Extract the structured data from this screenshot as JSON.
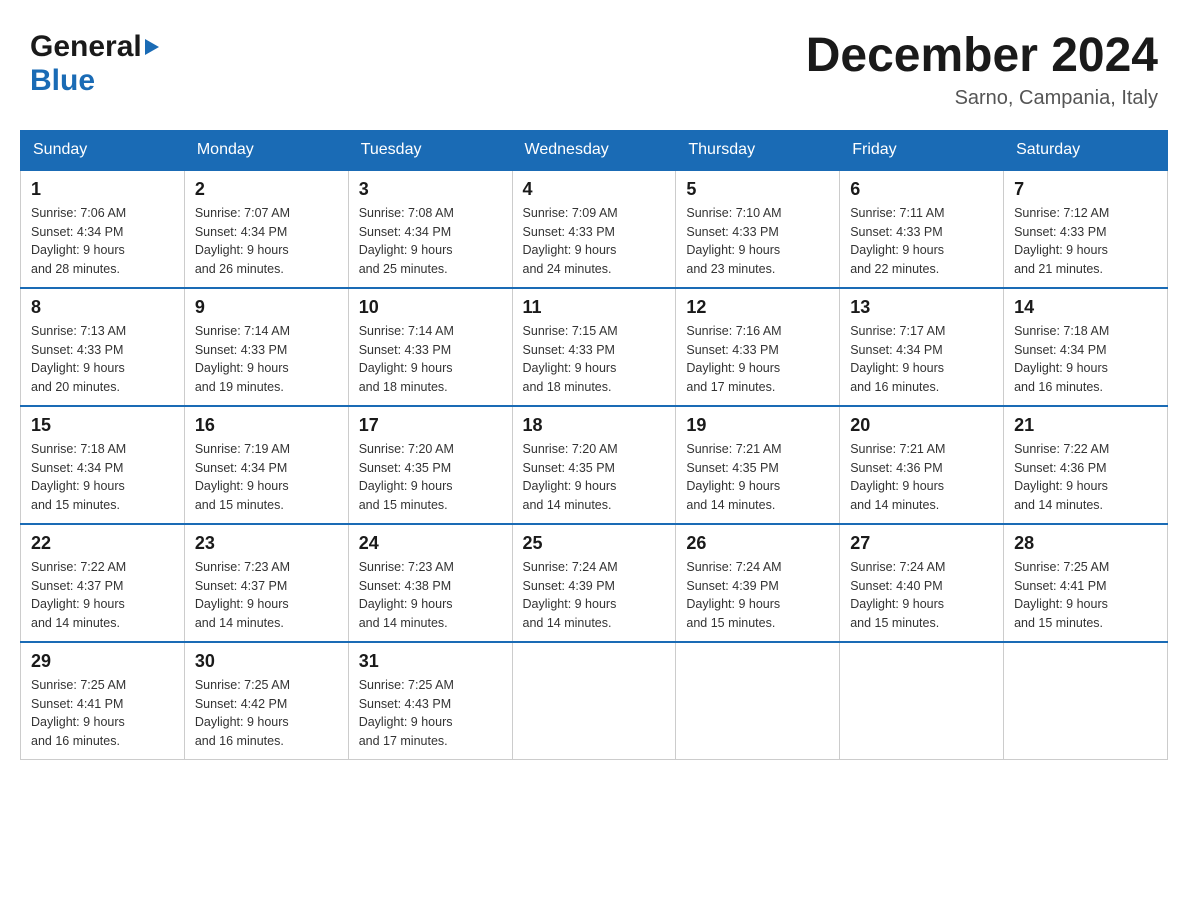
{
  "header": {
    "logo_general": "General",
    "logo_blue": "Blue",
    "month_title": "December 2024",
    "location": "Sarno, Campania, Italy"
  },
  "weekdays": [
    "Sunday",
    "Monday",
    "Tuesday",
    "Wednesday",
    "Thursday",
    "Friday",
    "Saturday"
  ],
  "weeks": [
    [
      {
        "day": "1",
        "sunrise": "7:06 AM",
        "sunset": "4:34 PM",
        "daylight": "9 hours and 28 minutes."
      },
      {
        "day": "2",
        "sunrise": "7:07 AM",
        "sunset": "4:34 PM",
        "daylight": "9 hours and 26 minutes."
      },
      {
        "day": "3",
        "sunrise": "7:08 AM",
        "sunset": "4:34 PM",
        "daylight": "9 hours and 25 minutes."
      },
      {
        "day": "4",
        "sunrise": "7:09 AM",
        "sunset": "4:33 PM",
        "daylight": "9 hours and 24 minutes."
      },
      {
        "day": "5",
        "sunrise": "7:10 AM",
        "sunset": "4:33 PM",
        "daylight": "9 hours and 23 minutes."
      },
      {
        "day": "6",
        "sunrise": "7:11 AM",
        "sunset": "4:33 PM",
        "daylight": "9 hours and 22 minutes."
      },
      {
        "day": "7",
        "sunrise": "7:12 AM",
        "sunset": "4:33 PM",
        "daylight": "9 hours and 21 minutes."
      }
    ],
    [
      {
        "day": "8",
        "sunrise": "7:13 AM",
        "sunset": "4:33 PM",
        "daylight": "9 hours and 20 minutes."
      },
      {
        "day": "9",
        "sunrise": "7:14 AM",
        "sunset": "4:33 PM",
        "daylight": "9 hours and 19 minutes."
      },
      {
        "day": "10",
        "sunrise": "7:14 AM",
        "sunset": "4:33 PM",
        "daylight": "9 hours and 18 minutes."
      },
      {
        "day": "11",
        "sunrise": "7:15 AM",
        "sunset": "4:33 PM",
        "daylight": "9 hours and 18 minutes."
      },
      {
        "day": "12",
        "sunrise": "7:16 AM",
        "sunset": "4:33 PM",
        "daylight": "9 hours and 17 minutes."
      },
      {
        "day": "13",
        "sunrise": "7:17 AM",
        "sunset": "4:34 PM",
        "daylight": "9 hours and 16 minutes."
      },
      {
        "day": "14",
        "sunrise": "7:18 AM",
        "sunset": "4:34 PM",
        "daylight": "9 hours and 16 minutes."
      }
    ],
    [
      {
        "day": "15",
        "sunrise": "7:18 AM",
        "sunset": "4:34 PM",
        "daylight": "9 hours and 15 minutes."
      },
      {
        "day": "16",
        "sunrise": "7:19 AM",
        "sunset": "4:34 PM",
        "daylight": "9 hours and 15 minutes."
      },
      {
        "day": "17",
        "sunrise": "7:20 AM",
        "sunset": "4:35 PM",
        "daylight": "9 hours and 15 minutes."
      },
      {
        "day": "18",
        "sunrise": "7:20 AM",
        "sunset": "4:35 PM",
        "daylight": "9 hours and 14 minutes."
      },
      {
        "day": "19",
        "sunrise": "7:21 AM",
        "sunset": "4:35 PM",
        "daylight": "9 hours and 14 minutes."
      },
      {
        "day": "20",
        "sunrise": "7:21 AM",
        "sunset": "4:36 PM",
        "daylight": "9 hours and 14 minutes."
      },
      {
        "day": "21",
        "sunrise": "7:22 AM",
        "sunset": "4:36 PM",
        "daylight": "9 hours and 14 minutes."
      }
    ],
    [
      {
        "day": "22",
        "sunrise": "7:22 AM",
        "sunset": "4:37 PM",
        "daylight": "9 hours and 14 minutes."
      },
      {
        "day": "23",
        "sunrise": "7:23 AM",
        "sunset": "4:37 PM",
        "daylight": "9 hours and 14 minutes."
      },
      {
        "day": "24",
        "sunrise": "7:23 AM",
        "sunset": "4:38 PM",
        "daylight": "9 hours and 14 minutes."
      },
      {
        "day": "25",
        "sunrise": "7:24 AM",
        "sunset": "4:39 PM",
        "daylight": "9 hours and 14 minutes."
      },
      {
        "day": "26",
        "sunrise": "7:24 AM",
        "sunset": "4:39 PM",
        "daylight": "9 hours and 15 minutes."
      },
      {
        "day": "27",
        "sunrise": "7:24 AM",
        "sunset": "4:40 PM",
        "daylight": "9 hours and 15 minutes."
      },
      {
        "day": "28",
        "sunrise": "7:25 AM",
        "sunset": "4:41 PM",
        "daylight": "9 hours and 15 minutes."
      }
    ],
    [
      {
        "day": "29",
        "sunrise": "7:25 AM",
        "sunset": "4:41 PM",
        "daylight": "9 hours and 16 minutes."
      },
      {
        "day": "30",
        "sunrise": "7:25 AM",
        "sunset": "4:42 PM",
        "daylight": "9 hours and 16 minutes."
      },
      {
        "day": "31",
        "sunrise": "7:25 AM",
        "sunset": "4:43 PM",
        "daylight": "9 hours and 17 minutes."
      },
      null,
      null,
      null,
      null
    ]
  ],
  "labels": {
    "sunrise": "Sunrise:",
    "sunset": "Sunset:",
    "daylight": "Daylight:"
  }
}
